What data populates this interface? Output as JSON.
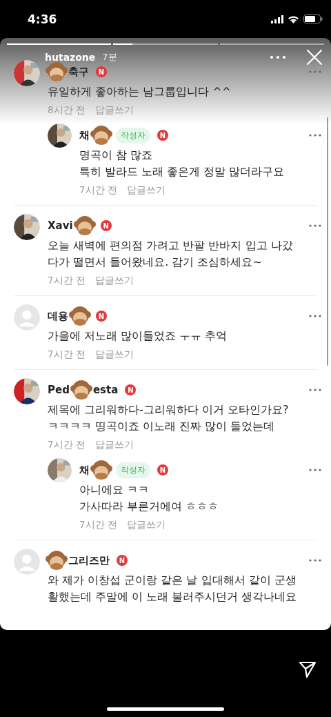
{
  "status_bar": {
    "time": "4:36"
  },
  "story": {
    "progress": [
      {
        "kind": "segment",
        "level": 1
      },
      {
        "kind": "segment",
        "level": 0.18
      },
      {
        "kind": "segment"
      }
    ],
    "account": "hutazone",
    "age": "7분"
  },
  "comments": [
    {
      "avatar": {
        "kind": "picture"
      },
      "name_parts": [
        {
          "kind": "sticker"
        },
        {
          "kind": "text",
          "text": "축구"
        }
      ],
      "badge": "N",
      "lines": [
        "유일하게 좋아하는 남그룹입니다 ^^"
      ],
      "time": "8시간 전",
      "reply_link": "답글쓰기",
      "replies": [
        {
          "avatar": {
            "kind": "picture"
          },
          "name_parts": [
            {
              "kind": "text",
              "text": "채"
            },
            {
              "kind": "sticker"
            }
          ],
          "tag": "작성자",
          "badge": "N",
          "lines": [
            "명곡이 참 많죠",
            "특히 발라드 노래 좋은게 정말 많더라구요"
          ],
          "time": "7시간 전",
          "reply_link": "답글쓰기"
        }
      ]
    },
    {
      "avatar": {
        "kind": "picture"
      },
      "name_parts": [
        {
          "kind": "text",
          "text": "Xavi"
        },
        {
          "kind": "sticker"
        }
      ],
      "badge": "N",
      "lines": [
        "오늘 새벽에 편의점 가려고 반팔 반바지 입고 나갔",
        "다가 떨면서 들어왔네요. 감기 조심하세요~"
      ],
      "time": "7시간 전",
      "reply_link": "답글쓰기"
    },
    {
      "avatar": {
        "kind": "placeholder"
      },
      "name_parts": [
        {
          "kind": "text",
          "text": "데용"
        },
        {
          "kind": "sticker"
        }
      ],
      "badge": "N",
      "lines": [
        "가을에 저노래 많이들었죠 ㅜㅠ 추억"
      ],
      "time": "7시간 전",
      "reply_link": "답글쓰기"
    },
    {
      "avatar": {
        "kind": "picture"
      },
      "name_parts": [
        {
          "kind": "text",
          "text": "Ped"
        },
        {
          "kind": "sticker"
        },
        {
          "kind": "text",
          "text": "esta"
        }
      ],
      "badge": "N",
      "lines": [
        "제목에 그리워하다-그리워하다 이거 오타인가요?",
        "ㅋㅋㅋㅋ 띵곡이죠 이노래 진짜 많이 들었는데"
      ],
      "time": "7시간 전",
      "reply_link": "답글쓰기",
      "replies": [
        {
          "avatar": {
            "kind": "picture"
          },
          "name_parts": [
            {
              "kind": "text",
              "text": "채"
            },
            {
              "kind": "sticker"
            }
          ],
          "tag": "작성자",
          "badge": "N",
          "lines": [
            "아니에요 ㅋㅋ",
            "가사따라 부른거에여 ㅎㅎㅎ"
          ],
          "time": "7시간 전",
          "reply_link": "답글쓰기"
        }
      ]
    },
    {
      "avatar": {
        "kind": "placeholder"
      },
      "name_parts": [
        {
          "kind": "sticker"
        },
        {
          "kind": "text",
          "text": "그리즈만"
        }
      ],
      "badge": "N",
      "lines": [
        "와 제가 이창섭 군이랑 같은 날 입대해서 같이 군생",
        "활했는데 주말에 이 노래 불러주시던거 생각나네요"
      ]
    }
  ]
}
